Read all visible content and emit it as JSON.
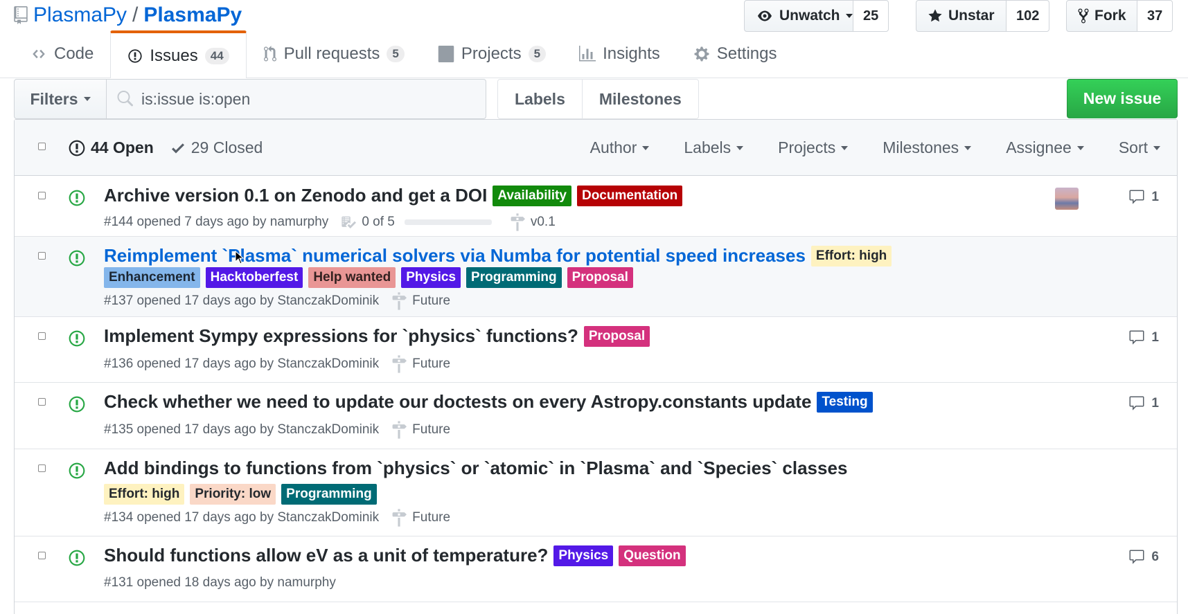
{
  "repo": {
    "owner": "PlasmaPy",
    "separator": "/",
    "name": "PlasmaPy"
  },
  "actions": {
    "watch": {
      "label": "Unwatch",
      "count": "25"
    },
    "star": {
      "label": "Unstar",
      "count": "102"
    },
    "fork": {
      "label": "Fork",
      "count": "37"
    }
  },
  "tabs": [
    {
      "label": "Code",
      "counter": ""
    },
    {
      "label": "Issues",
      "counter": "44"
    },
    {
      "label": "Pull requests",
      "counter": "5"
    },
    {
      "label": "Projects",
      "counter": "5"
    },
    {
      "label": "Insights",
      "counter": ""
    },
    {
      "label": "Settings",
      "counter": ""
    }
  ],
  "subnav": {
    "filters_label": "Filters",
    "search_value": "is:issue is:open",
    "labels_label": "Labels",
    "milestones_label": "Milestones",
    "new_issue_label": "New issue"
  },
  "list_header": {
    "open_label": "44 Open",
    "closed_label": "29 Closed",
    "filters": [
      "Author",
      "Labels",
      "Projects",
      "Milestones",
      "Assignee",
      "Sort"
    ]
  },
  "issues": [
    {
      "title": "Archive version 0.1 on Zenodo and get a DOI",
      "meta": "#144 opened 7 days ago by namurphy",
      "tasks": "0 of 5",
      "milestone": "v0.1",
      "comments": "1",
      "labels": [
        {
          "name": "Availability",
          "bg": "#128a0c",
          "fg": "#ffffff"
        },
        {
          "name": "Documentation",
          "bg": "#b60205",
          "fg": "#ffffff"
        }
      ]
    },
    {
      "title": "Reimplement `Plasma` numerical solvers via Numba for potential speed increases",
      "meta": "#137 opened 17 days ago by StanczakDominik",
      "milestone": "Future",
      "comments": "",
      "labels": [
        {
          "name": "Effort: high",
          "bg": "#fef2c0",
          "fg": "#24292e"
        },
        {
          "name": "Enhancement",
          "bg": "#84b6eb",
          "fg": "#1c2733"
        },
        {
          "name": "Hacktoberfest",
          "bg": "#5319e7",
          "fg": "#ffffff"
        },
        {
          "name": "Help wanted",
          "bg": "#e99695",
          "fg": "#332120"
        },
        {
          "name": "Physics",
          "bg": "#5319e7",
          "fg": "#ffffff"
        },
        {
          "name": "Programming",
          "bg": "#006b75",
          "fg": "#ffffff"
        },
        {
          "name": "Proposal",
          "bg": "#d4317d",
          "fg": "#ffffff"
        }
      ]
    },
    {
      "title": "Implement Sympy expressions for `physics` functions?",
      "meta": "#136 opened 17 days ago by StanczakDominik",
      "milestone": "Future",
      "comments": "1",
      "labels": [
        {
          "name": "Proposal",
          "bg": "#d4317d",
          "fg": "#ffffff"
        }
      ]
    },
    {
      "title": "Check whether we need to update our doctests on every Astropy.constants update",
      "meta": "#135 opened 17 days ago by StanczakDominik",
      "milestone": "Future",
      "comments": "1",
      "labels": [
        {
          "name": "Testing",
          "bg": "#0052cc",
          "fg": "#ffffff"
        }
      ]
    },
    {
      "title": "Add bindings to functions from `physics` or `atomic` in `Plasma` and `Species` classes",
      "meta": "#134 opened 17 days ago by StanczakDominik",
      "milestone": "Future",
      "comments": "",
      "labels": [
        {
          "name": "Effort: high",
          "bg": "#fef2c0",
          "fg": "#24292e"
        },
        {
          "name": "Priority: low",
          "bg": "#fad8c7",
          "fg": "#24292e"
        },
        {
          "name": "Programming",
          "bg": "#006b75",
          "fg": "#ffffff"
        }
      ]
    },
    {
      "title": "Should functions allow eV as a unit of temperature?",
      "meta": "#131 opened 18 days ago by namurphy",
      "milestone": "",
      "comments": "6",
      "labels": [
        {
          "name": "Physics",
          "bg": "#5319e7",
          "fg": "#ffffff"
        },
        {
          "name": "Question",
          "bg": "#d4317d",
          "fg": "#ffffff"
        }
      ]
    }
  ]
}
